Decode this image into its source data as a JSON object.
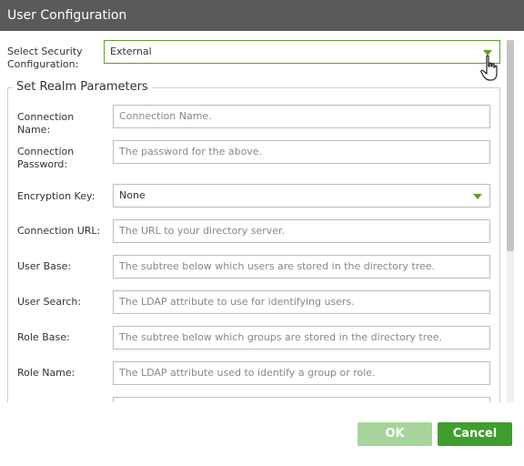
{
  "dialog": {
    "title": "User Configuration"
  },
  "security": {
    "label": "Select Security Configuration:",
    "value": "External"
  },
  "realm": {
    "legend": "Set Realm Parameters",
    "fields": [
      {
        "label": "Connection Name:",
        "placeholder": "Connection Name."
      },
      {
        "label": "Connection Password:",
        "placeholder": "The password for the above."
      },
      {
        "label": "Encryption Key:",
        "value": "None"
      },
      {
        "label": "Connection URL:",
        "placeholder": "The URL to your directory server."
      },
      {
        "label": "User Base:",
        "placeholder": "The subtree below which users are stored in the directory tree."
      },
      {
        "label": "User Search:",
        "placeholder": "The LDAP attribute to use for identifying users."
      },
      {
        "label": "Role Base:",
        "placeholder": "The subtree below which groups are stored in the directory tree."
      },
      {
        "label": "Role Name:",
        "placeholder": "The LDAP attribute used to identify a group or role."
      }
    ]
  },
  "buttons": {
    "ok": "OK",
    "cancel": "Cancel"
  },
  "colors": {
    "accent": "#3f9e2e",
    "titlebar": "#5a5a5a"
  }
}
